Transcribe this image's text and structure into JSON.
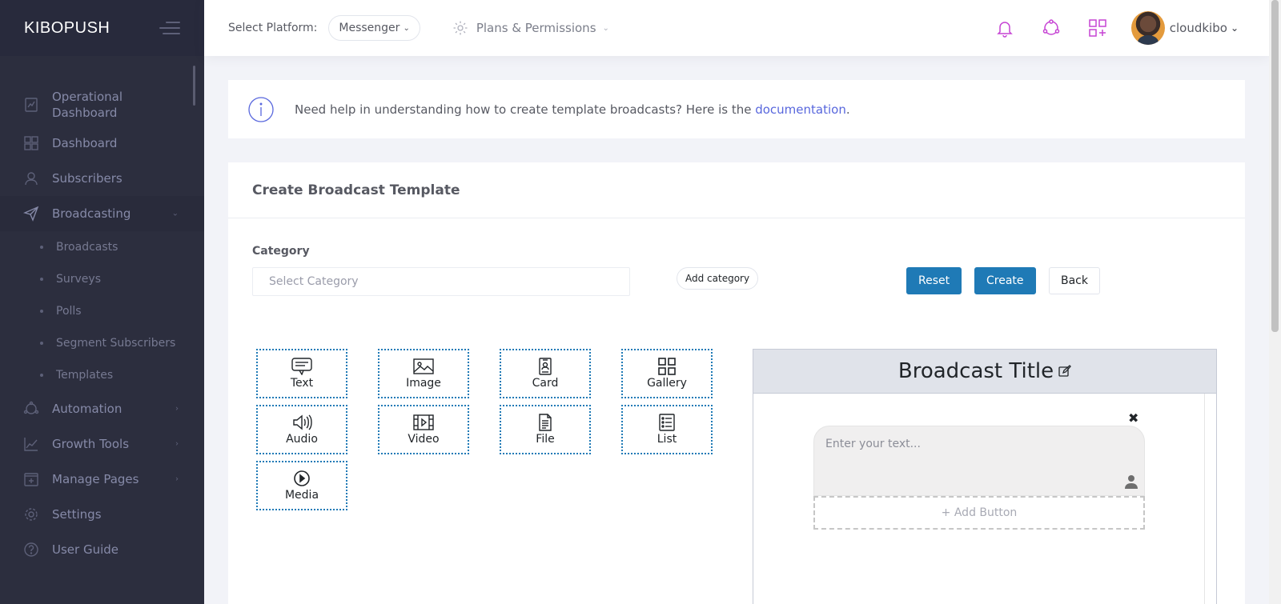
{
  "sidebar": {
    "brand": "KIBOPUSH",
    "items": [
      {
        "label": "Operational Dashboard",
        "icon": "dashboard-chart-icon"
      },
      {
        "label": "Dashboard",
        "icon": "grid-icon"
      },
      {
        "label": "Subscribers",
        "icon": "user-icon"
      },
      {
        "label": "Broadcasting",
        "icon": "paper-plane-icon"
      },
      {
        "label": "Automation",
        "icon": "automation-icon"
      },
      {
        "label": "Growth Tools",
        "icon": "chart-line-icon"
      },
      {
        "label": "Manage Pages",
        "icon": "pages-icon"
      },
      {
        "label": "Settings",
        "icon": "gear-icon"
      },
      {
        "label": "User Guide",
        "icon": "question-icon"
      }
    ],
    "broadcasting_sub": [
      "Broadcasts",
      "Surveys",
      "Polls",
      "Segment Subscribers",
      "Templates"
    ]
  },
  "header": {
    "platform_label": "Select Platform:",
    "platform_value": "Messenger",
    "plans_label": "Plans & Permissions",
    "username": "cloudkibo"
  },
  "info": {
    "text": "Need help in understanding how to create template broadcasts? Here is the ",
    "link": "documentation",
    "suffix": "."
  },
  "portlet": {
    "title": "Create Broadcast Template",
    "category_label": "Category",
    "category_placeholder": "Select Category",
    "add_category": "Add category",
    "reset": "Reset",
    "create": "Create",
    "back": "Back"
  },
  "components": [
    "Text",
    "Image",
    "Card",
    "Gallery",
    "Audio",
    "Video",
    "File",
    "List",
    "Media"
  ],
  "preview": {
    "title": "Broadcast Title",
    "close": "✖",
    "text_placeholder": "Enter your text...",
    "add_button": "+ Add Button"
  },
  "colors": {
    "sidebar_bg": "#2c2e3e",
    "primary": "#1f7ab6",
    "link": "#5867dd",
    "header_icon": "#c644d4"
  }
}
